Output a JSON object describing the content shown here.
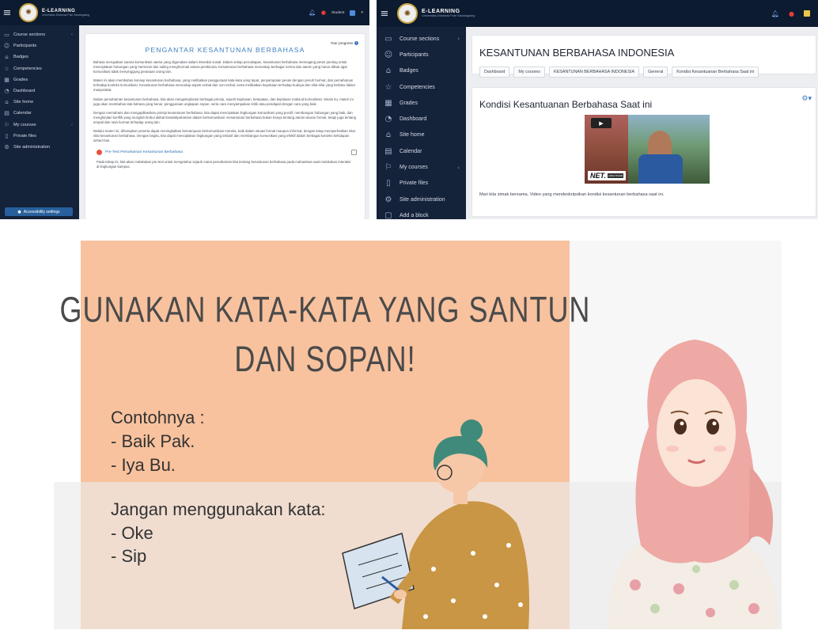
{
  "brand": {
    "name": "E-LEARNING",
    "subtitle": "Universitas Dharmas Putri Sawahgaang"
  },
  "colors": {
    "topbar": "#0d1b30",
    "sidebar": "#14223a",
    "accent": "#27609c",
    "slide_bg": "#f8c29e"
  },
  "shot1": {
    "user": "Student",
    "nav": [
      {
        "label": "Course sections",
        "icon": "folder-icon"
      },
      {
        "label": "Participants",
        "icon": "users-icon"
      },
      {
        "label": "Badges",
        "icon": "badge-icon"
      },
      {
        "label": "Competencies",
        "icon": "star-icon"
      },
      {
        "label": "Grades",
        "icon": "table-icon"
      },
      {
        "label": "Dashboard",
        "icon": "dashboard-icon"
      },
      {
        "label": "Site home",
        "icon": "home-icon"
      },
      {
        "label": "Calendar",
        "icon": "calendar-icon"
      },
      {
        "label": "My courses",
        "icon": "courses-icon"
      },
      {
        "label": "Private files",
        "icon": "file-icon"
      },
      {
        "label": "Site administration",
        "icon": "admin-icon"
      }
    ],
    "accessibility": "Accessibility settings",
    "title": "PENGANTAR KESANTUNAN BERBAHASA",
    "progress_label": "Your progress",
    "paragraphs": [
      "Bahasa merupakan sarana komunikasi utama yang digunakan dalam interaksi sosial. Dalam setiap percakapan, kesantunan berbahasa memegang peran penting untuk menciptakan hubungan yang harmonis dan saling menghormati antara pembicara. Kesantunan berbahasa mencakup berbagai norma dan aturan yang harus diikuti agar komunikasi tidak menyinggung perasaan orang lain.",
      "Materi ini akan membahas konsep kesantunan berbahasa, yang melibatkan penggunaan kata-kata yang tepat, penyampaian pesan dengan penuh hormat, dan pemahaman terhadap konteks komunikasi. Kesantunan berbahasa mencakup aspek verbal dan non-verbal, serta melibatkan kepekaan terhadap budaya dan nilai-nilai yang berlaku dalam masyarakat.",
      "Dalam pemahaman kesantunan berbahasa, kita akan mengeksplorasi berbagai prinsip, seperti kejelasan, ketepatan, dan kejelasan maksud komunikasi. Selain itu, materi ini juga akan membahas tata bahasa yang benar, penggunaan ungkapan sopan, serta cara menyampaikan kritik atau pendapat dengan cara yang baik.",
      "Dengan memahami dan mengaplikasikan prinsip kesantunan berbahasa, kita dapat menciptakan lingkungan komunikasi yang positif, membangun hubungan yang baik, dan menghindari konflik yang mungkin timbul akibat kesalahpahaman dalam berkomunikasi. Kesantunan berbahasa bukan hanya tentang aturan-aturan formal, tetapi juga tentang empati dan rasa hormat terhadap orang lain.",
      "Melalui materi ini, diharapkan peserta dapat meningkatkan kemampuan berkomunikasi mereka, baik dalam situasi formal maupun informal, dengan tetap memperhatikan nilai-nilai kesantunan berbahasa. Dengan begitu, kita dapat menciptakan lingkungan yang inklusif dan membangun komunikasi yang efektif dalam berbagai konteks kehidupan sehari-hari."
    ],
    "activity": "Pre-Test Pemahaman Kesantunan Berbahasa",
    "activity_desc": "Pada tahap ini, kita akan melakukan pre-test untuk mengetahui sejauh mana pemahaman kita tentang kesantunan berbahasa pada mahasiswa saat melakukan interaksi di lingkungan kampus."
  },
  "shot2": {
    "nav": [
      {
        "label": "Course sections",
        "icon": "folder-icon"
      },
      {
        "label": "Participants",
        "icon": "users-icon"
      },
      {
        "label": "Badges",
        "icon": "badge-icon"
      },
      {
        "label": "Competencies",
        "icon": "star-icon"
      },
      {
        "label": "Grades",
        "icon": "table-icon"
      },
      {
        "label": "Dashboard",
        "icon": "dashboard-icon"
      },
      {
        "label": "Site home",
        "icon": "home-icon"
      },
      {
        "label": "Calendar",
        "icon": "calendar-icon"
      },
      {
        "label": "My courses",
        "icon": "courses-icon"
      },
      {
        "label": "Private files",
        "icon": "file-icon"
      },
      {
        "label": "Site administration",
        "icon": "admin-icon"
      },
      {
        "label": "Add a block",
        "icon": "add-icon"
      }
    ],
    "course_title": "KESANTUNAN BERBAHASA INDONESIA",
    "breadcrumbs": [
      "Dashboard",
      "My courses",
      "KESANTUNAN BERBAHASA INDONESIA",
      "General",
      "Kondisi Kesantuanan Berbahasa Saat ini"
    ],
    "section_title": "Kondisi Kesantuanan Berbahasa Saat ini",
    "video_logo": "NET.",
    "video_logo_sub": "JAWA TIMUR",
    "description": "Mari kita simak bersama, Video yang mendeskripsikan kondisi kesantunan berbahasa saat ini."
  },
  "slide": {
    "heading_line1": "GUNAKAN KATA-KATA YANG SANTUN",
    "heading_line2": "DAN SOPAN!",
    "examples_label": "Contohnya :",
    "examples": [
      "- Baik Pak.",
      "- Iya Bu."
    ],
    "avoid_label": "Jangan menggunakan kata:",
    "avoid": [
      "- Oke",
      "- Sip"
    ]
  }
}
